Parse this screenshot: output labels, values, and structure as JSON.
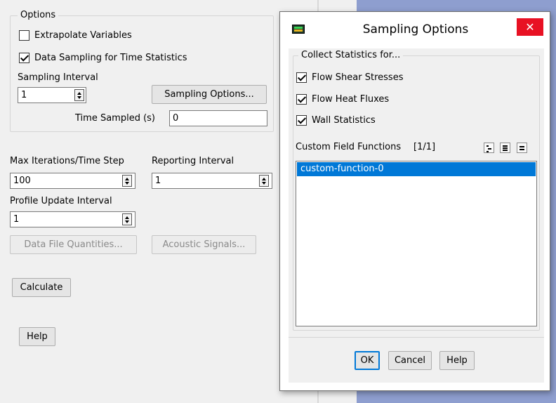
{
  "left": {
    "options_legend": "Options",
    "extrapolate_label": "Extrapolate Variables",
    "extrapolate_checked": false,
    "data_sampling_label": "Data Sampling for Time Statistics",
    "data_sampling_checked": true,
    "sampling_interval_label": "Sampling Interval",
    "sampling_interval_value": "1",
    "sampling_options_button": "Sampling Options...",
    "time_sampled_label": "Time Sampled (s)",
    "time_sampled_value": "0",
    "max_iter_label": "Max Iterations/Time Step",
    "max_iter_value": "100",
    "reporting_interval_label": "Reporting Interval",
    "reporting_interval_value": "1",
    "profile_update_label": "Profile Update Interval",
    "profile_update_value": "1",
    "data_file_quantities_button": "Data File Quantities...",
    "acoustic_signals_button": "Acoustic Signals...",
    "calculate_button": "Calculate",
    "help_button": "Help"
  },
  "dialog": {
    "title": "Sampling Options",
    "close_glyph": "✕",
    "collect_legend": "Collect Statistics for...",
    "checks": [
      {
        "label": "Flow Shear Stresses",
        "checked": true
      },
      {
        "label": "Flow Heat Fluxes",
        "checked": true
      },
      {
        "label": "Wall Statistics",
        "checked": true
      }
    ],
    "cff_label": "Custom Field Functions",
    "cff_count": "[1/1]",
    "cff_items": [
      "custom-function-0"
    ],
    "ok_button": "OK",
    "cancel_button": "Cancel",
    "help_button": "Help"
  },
  "colors": {
    "selection": "#0078d7",
    "close": "#e81123",
    "background_window": "#8e9ecf"
  }
}
